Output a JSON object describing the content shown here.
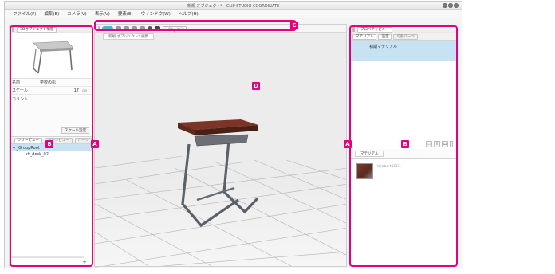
{
  "window": {
    "title": "新規 オブジェクト* - CLIP STUDIO COORDINATE"
  },
  "menu": {
    "items": [
      "ファイル(F)",
      "編集(E)",
      "カメラ(V)",
      "表示(V)",
      "要素(E)",
      "ウィンドウ(W)",
      "ヘルプ(H)"
    ]
  },
  "left_panel": {
    "tab": "3Dオブジェクト情報",
    "props": [
      {
        "key": "名前",
        "value": "学校の机",
        "unit": ""
      },
      {
        "key": "スケール",
        "value": "17",
        "unit": "cm"
      },
      {
        "key": "コメント",
        "value": "",
        "unit": ""
      }
    ],
    "scale_button": "スケール設定",
    "tree_tabs": [
      "ツリービュー",
      "ボーンビュー",
      "パーツ"
    ],
    "tree": [
      {
        "label": "_GroupRoot",
        "selected": true
      },
      {
        "label": "sh_desk_02",
        "selected": false
      }
    ]
  },
  "viewport": {
    "camera_field": "CLIPカメラパーセ",
    "tab": "新規 オブジェクト* 編集"
  },
  "right_panel": {
    "tab": "プロパティビュー",
    "subtabs": [
      "マテリアル",
      "設定",
      "可動パーツ"
    ],
    "material_item": "初期マテリアル",
    "bottom_tab": "マテリアル",
    "texture_label": "lambert1SG1"
  },
  "annotations": {
    "labels": [
      "A",
      "A",
      "B",
      "B",
      "C",
      "D"
    ],
    "color": "#e6007e"
  },
  "colors": {
    "accent": "#4bb3d6",
    "selection": "#c7e2f3",
    "annotation": "#e6007e"
  }
}
